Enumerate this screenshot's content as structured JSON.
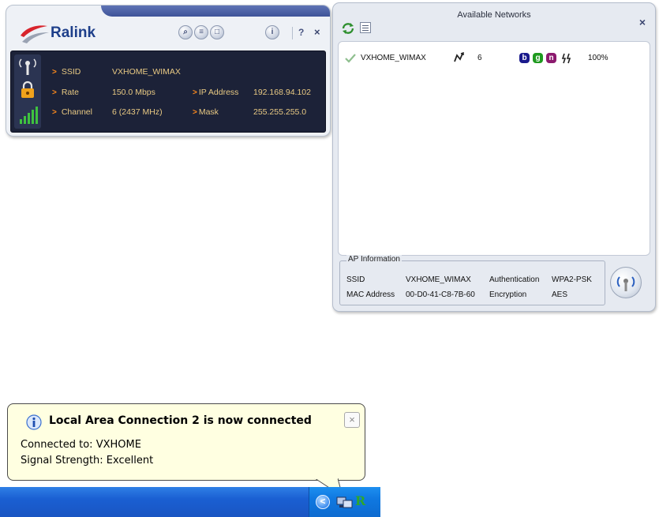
{
  "ralink": {
    "brand": "Ralink",
    "ssid_label": "SSID",
    "ssid_value": "VXHOME_WIMAX",
    "rate_label": "Rate",
    "rate_value": "150.0 Mbps",
    "ip_label": "IP Address",
    "ip_value": "192.168.94.102",
    "channel_label": "Channel",
    "channel_value": "6 (2437 MHz)",
    "mask_label": "Mask",
    "mask_value": "255.255.255.0",
    "help": "?",
    "close": "×",
    "info": "i"
  },
  "available": {
    "title": "Available Networks",
    "close": "×",
    "networks": [
      {
        "ssid": "VXHOME_WIMAX",
        "channel": "6",
        "signal": "100%",
        "badges": [
          "b",
          "g",
          "n"
        ]
      }
    ],
    "ap_info": {
      "legend": "AP Information",
      "ssid_label": "SSID",
      "ssid_value": "VXHOME_WIMAX",
      "auth_label": "Authentication",
      "auth_value": "WPA2-PSK",
      "mac_label": "MAC Address",
      "mac_value": "00-D0-41-C8-7B-60",
      "enc_label": "Encryption",
      "enc_value": "AES"
    }
  },
  "balloon": {
    "title": "Local Area Connection 2 is now connected",
    "line1": "Connected to: VXHOME",
    "line2": "Signal Strength: Excellent",
    "close": "×"
  },
  "colors": {
    "badge_b": "#1a1a8c",
    "badge_g": "#1f9a1f",
    "badge_n": "#8c1a6e",
    "accent_orange": "#ff8a1c"
  }
}
